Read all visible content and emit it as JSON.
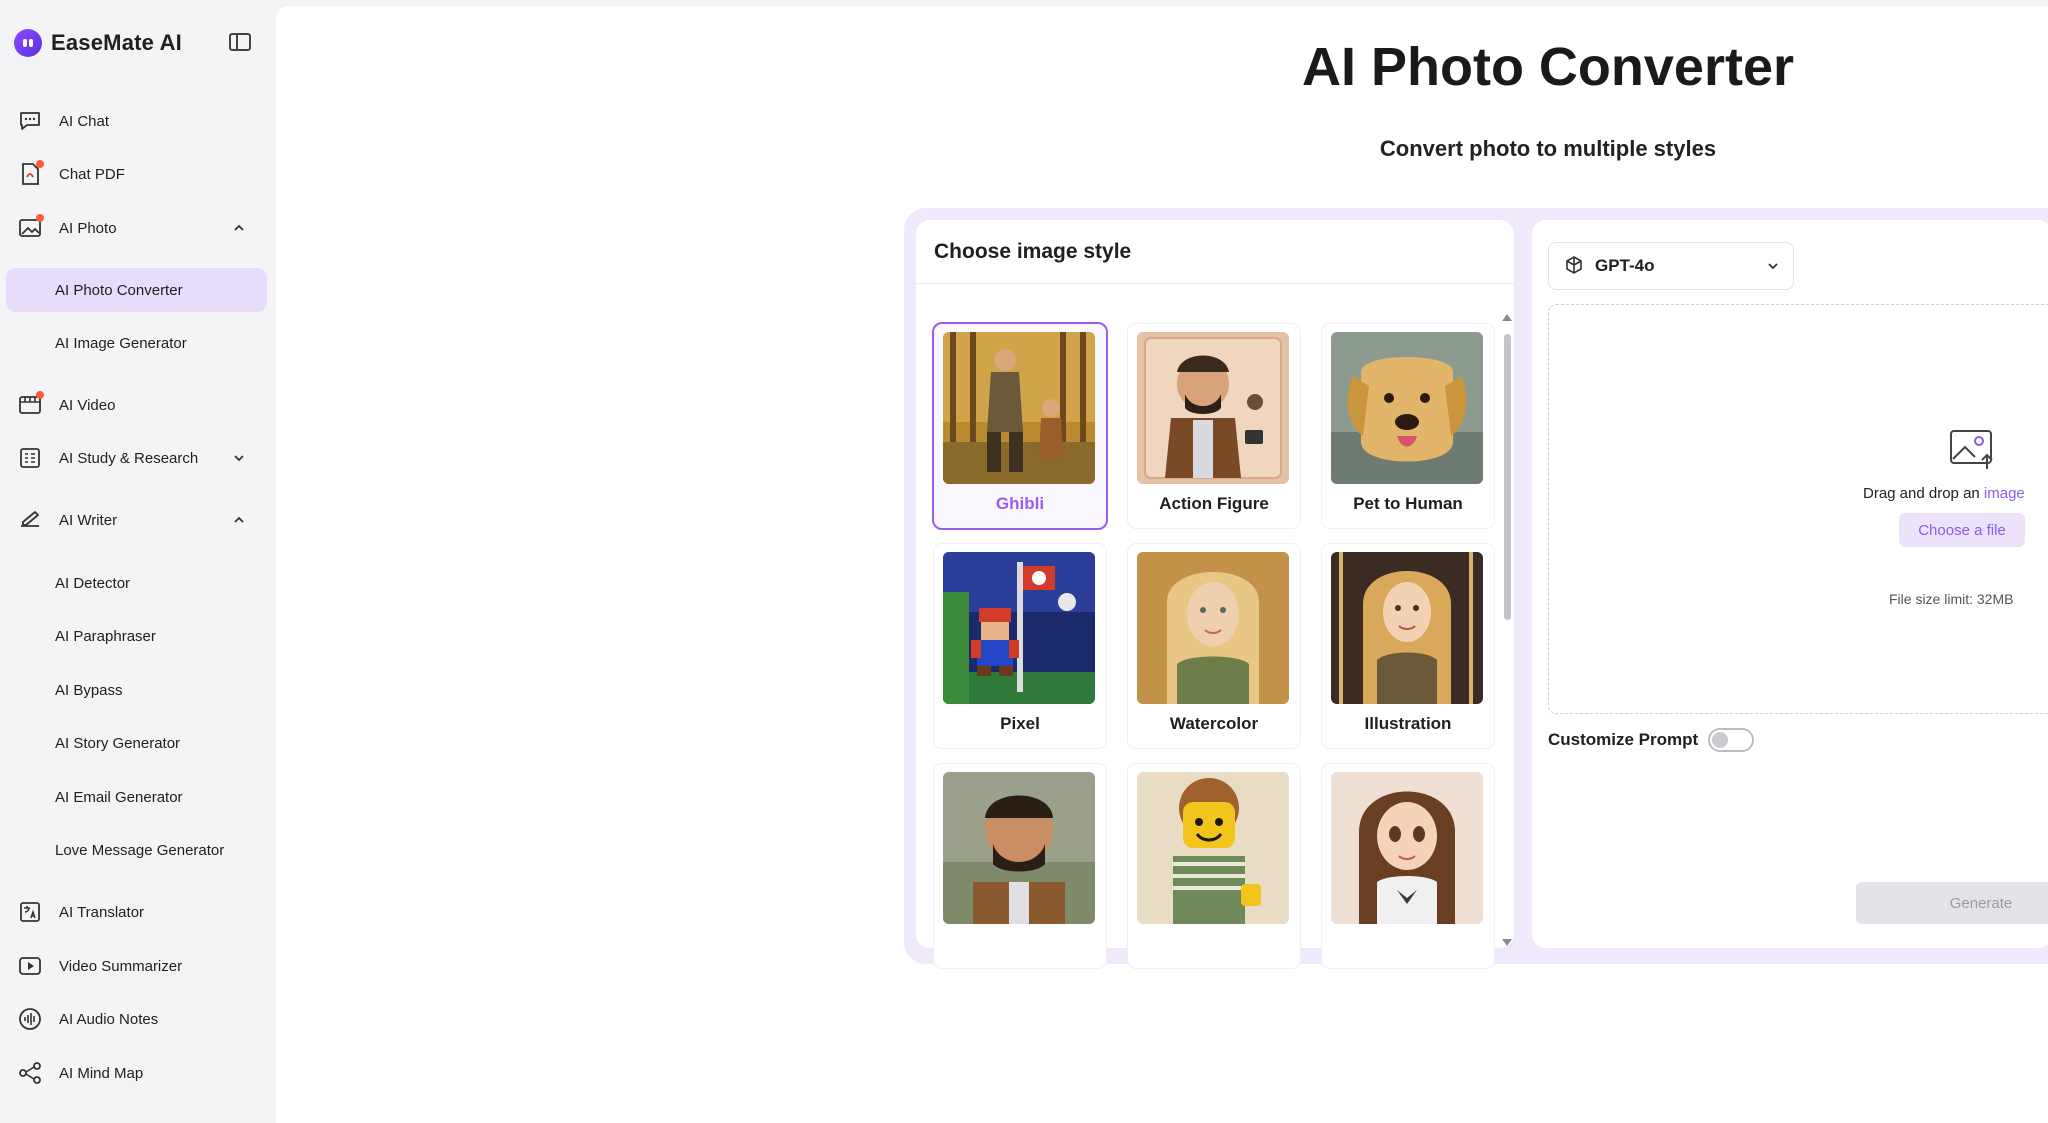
{
  "brand": {
    "name": "EaseMate AI"
  },
  "sidebar": {
    "items": [
      {
        "label": "AI Chat"
      },
      {
        "label": "Chat PDF"
      },
      {
        "label": "AI Photo"
      },
      {
        "label": "AI Photo Converter"
      },
      {
        "label": "AI Image Generator"
      },
      {
        "label": "AI Video"
      },
      {
        "label": "AI Study & Research"
      },
      {
        "label": "AI Writer"
      },
      {
        "label": "AI Detector"
      },
      {
        "label": "AI Paraphraser"
      },
      {
        "label": "AI Bypass"
      },
      {
        "label": "AI Story Generator"
      },
      {
        "label": "AI Email Generator"
      },
      {
        "label": "Love Message Generator"
      },
      {
        "label": "AI Translator"
      },
      {
        "label": "Video Summarizer"
      },
      {
        "label": "AI Audio Notes"
      },
      {
        "label": "AI Mind Map"
      }
    ]
  },
  "main": {
    "title": "AI Photo Converter",
    "subtitle": "Convert photo to multiple styles",
    "style_panel": {
      "heading": "Choose image style",
      "styles": [
        {
          "label": "Ghibli",
          "selected": true
        },
        {
          "label": "Action Figure",
          "selected": false
        },
        {
          "label": "Pet to Human",
          "selected": false
        },
        {
          "label": "Pixel",
          "selected": false
        },
        {
          "label": "Watercolor",
          "selected": false
        },
        {
          "label": "Illustration",
          "selected": false
        },
        {
          "label": "",
          "selected": false
        },
        {
          "label": "",
          "selected": false
        },
        {
          "label": "",
          "selected": false
        }
      ]
    },
    "upload_panel": {
      "model": "GPT-4o",
      "drop_text": "Drag and drop an ",
      "drop_link": "image",
      "choose_button": "Choose a file",
      "size_limit": "File size limit: 32MB",
      "customize_prompt": "Customize Prompt",
      "customize_prompt_enabled": false,
      "generate_button": "Generate"
    }
  },
  "colors": {
    "accent": "#9b5cf0",
    "active_nav_bg": "#e7dcfb",
    "notification_dot": "#ff5b3a"
  }
}
